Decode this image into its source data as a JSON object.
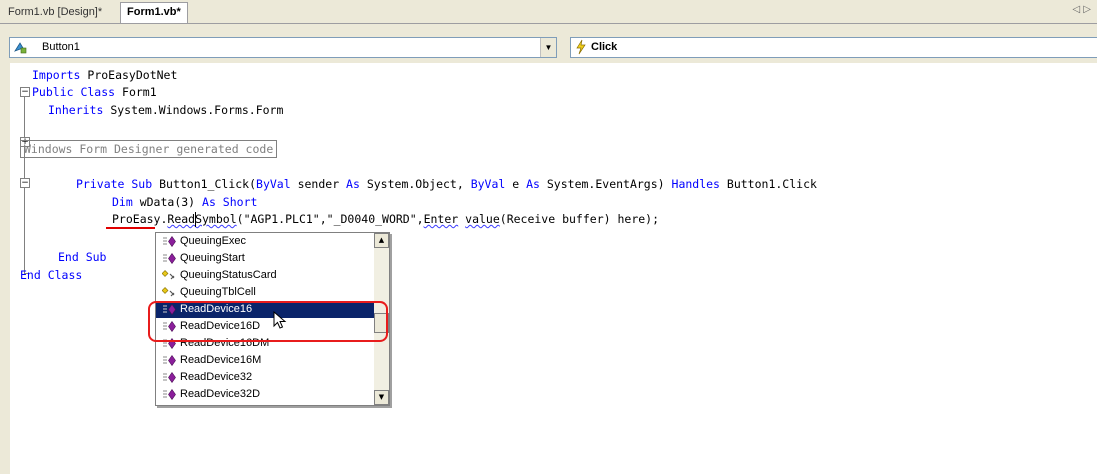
{
  "tabs": [
    {
      "label": "Form1.vb [Design]*"
    },
    {
      "label": "Form1.vb*"
    }
  ],
  "tab_scroll_icon": "left-right-arrows-icon",
  "nav": {
    "class_combo": "Button1",
    "method_combo": "Click"
  },
  "code": {
    "line1_kw": "Imports",
    "line1_rest": " ProEasyDotNet",
    "line2_kw": "Public Class",
    "line2_rest": " Form1",
    "line3_kw": "Inherits",
    "line3_rest": " System.Windows.Forms.Form",
    "region": "Windows Form Designer generated code",
    "sub_a": "Private Sub",
    "sub_b": " Button1_Click(",
    "sub_c": "ByVal",
    "sub_d": " sender ",
    "sub_e": "As",
    "sub_f": " System.Object, ",
    "sub_g": "ByVal",
    "sub_h": " e ",
    "sub_i": "As",
    "sub_j": " System.EventArgs) ",
    "sub_k": "Handles",
    "sub_l": " Button1.Click",
    "dim_a": "Dim",
    "dim_b": " wData(3) ",
    "dim_c": "As Short",
    "read_a": "ProEasy.",
    "read_b": "ReadSymbol",
    "read_c": "(\"AGP1.PLC1\",\"_D0040_WORD\",",
    "read_d": "Enter",
    "read_e": " ",
    "read_f": "value",
    "read_g": "(Receive buffer) here);",
    "endsub_a": "End Sub",
    "endclass_a": "End Class"
  },
  "intellisense": {
    "items": [
      {
        "label": "QueuingExec",
        "icon": "method-icon"
      },
      {
        "label": "QueuingStart",
        "icon": "method-icon"
      },
      {
        "label": "QueuingStatusCard",
        "icon": "property-icon"
      },
      {
        "label": "QueuingTblCell",
        "icon": "property-icon"
      },
      {
        "label": "ReadDevice16",
        "icon": "method-icon"
      },
      {
        "label": "ReadDevice16D",
        "icon": "method-icon"
      },
      {
        "label": "ReadDevice16DM",
        "icon": "method-icon"
      },
      {
        "label": "ReadDevice16M",
        "icon": "method-icon"
      },
      {
        "label": "ReadDevice32",
        "icon": "method-icon"
      },
      {
        "label": "ReadDevice32D",
        "icon": "method-icon"
      }
    ],
    "selected_index": 4
  },
  "colors": {
    "keyword": "#0000ff",
    "selection": "#0a246a",
    "annotation": "#e81c1c"
  }
}
